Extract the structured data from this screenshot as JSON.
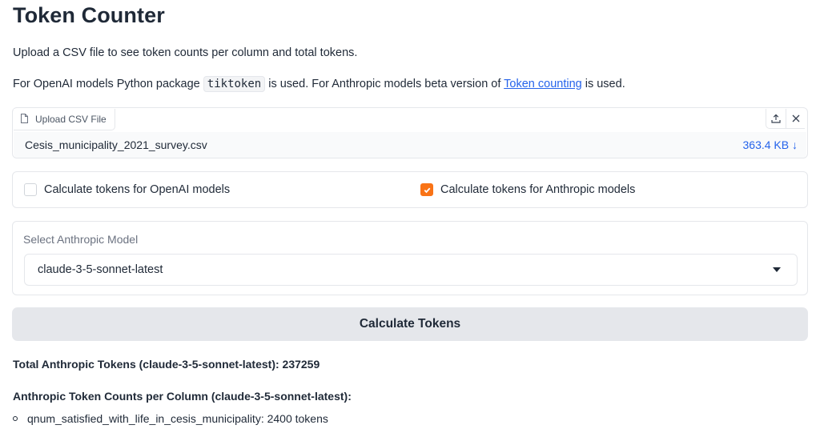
{
  "page": {
    "title": "Token Counter",
    "description1": "Upload a CSV file to see token counts per column and total tokens.",
    "description2_prefix": "For OpenAI models Python package ",
    "description2_code": "tiktoken",
    "description2_middle": " is used. For Anthropic models beta version of ",
    "description2_link": "Token counting",
    "description2_suffix": " is used."
  },
  "upload": {
    "label": "Upload CSV File",
    "file_name": "Cesis_municipality_2021_survey.csv",
    "file_size": "363.4 KB ↓"
  },
  "checkboxes": [
    {
      "label": "Calculate tokens for OpenAI models",
      "checked": false
    },
    {
      "label": "Calculate tokens for Anthropic models",
      "checked": true
    }
  ],
  "model_select": {
    "label": "Select Anthropic Model",
    "value": "claude-3-5-sonnet-latest"
  },
  "calculate_button": {
    "label": "Calculate Tokens"
  },
  "results": {
    "total": "Total Anthropic Tokens (claude-3-5-sonnet-latest): 237259",
    "per_column_heading": "Anthropic Token Counts per Column (claude-3-5-sonnet-latest):",
    "columns": [
      "qnum_satisfied_with_life_in_cesis_municipality: 2400 tokens"
    ]
  },
  "colors": {
    "accent": "#f97316",
    "link": "#2563eb"
  }
}
